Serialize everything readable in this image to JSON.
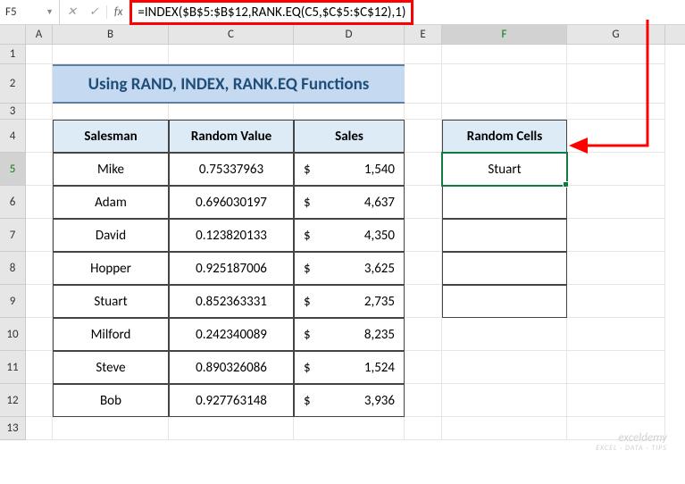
{
  "nameBox": "F5",
  "formula": "=INDEX($B$5:$B$12,RANK.EQ(C5,$C$5:$C$12),1)",
  "columns": [
    "A",
    "B",
    "C",
    "D",
    "E",
    "F",
    "G"
  ],
  "selectedCol": "F",
  "selectedRow": "5",
  "title": "Using RAND, INDEX, RANK.EQ Functions",
  "headers": {
    "b": "Salesman",
    "c": "Random Value",
    "d": "Sales",
    "f": "Random Cells"
  },
  "rows": [
    {
      "b": "Mike",
      "c": "0.75337963",
      "d": "1,540"
    },
    {
      "b": "Adam",
      "c": "0.696030197",
      "d": "4,637"
    },
    {
      "b": "David",
      "c": "0.123820133",
      "d": "4,350"
    },
    {
      "b": "Hopper",
      "c": "0.925187006",
      "d": "3,625"
    },
    {
      "b": "Stuart",
      "c": "0.852363331",
      "d": "2,735"
    },
    {
      "b": "Milford",
      "c": "0.242340089",
      "d": "8,235"
    },
    {
      "b": "Steve",
      "c": "0.890326086",
      "d": "1,524"
    },
    {
      "b": "Bob",
      "c": "0.927763148",
      "d": "3,936"
    }
  ],
  "currency": "$",
  "fCells": [
    "Stuart",
    "",
    "",
    "",
    ""
  ],
  "watermark1": "exceldemy",
  "watermark2": "EXCEL · DATA · TIPS"
}
